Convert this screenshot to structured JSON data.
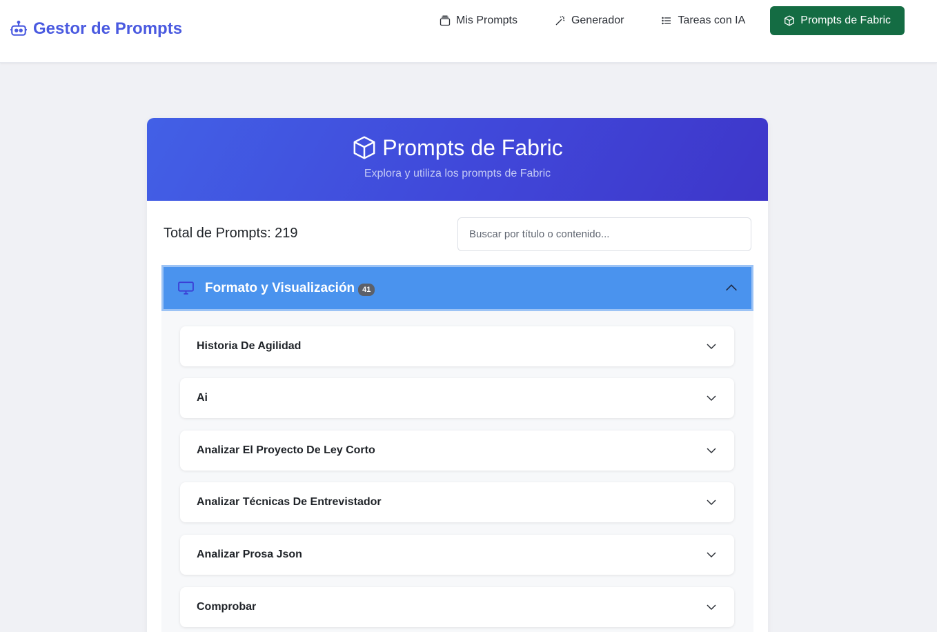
{
  "navbar": {
    "brand": "Gestor de Prompts",
    "brand_icon": "robot-icon",
    "links": [
      {
        "label": "Mis Prompts",
        "icon": "collection-icon"
      },
      {
        "label": "Generador",
        "icon": "magic-wand-icon"
      },
      {
        "label": "Tareas con IA",
        "icon": "list-icon"
      },
      {
        "label": "Prompts de Fabric",
        "icon": "box-icon",
        "active": true
      }
    ]
  },
  "header": {
    "title": "Prompts de Fabric",
    "subtitle": "Explora y utiliza los prompts de Fabric"
  },
  "stats": {
    "total_label": "Total de Prompts: 219"
  },
  "search": {
    "placeholder": "Buscar por título o contenido..."
  },
  "category": {
    "label": "Formato y Visualización",
    "count": "41",
    "icon": "monitor-icon",
    "expanded": true,
    "items": [
      {
        "label": "Historia De Agilidad"
      },
      {
        "label": "Ai"
      },
      {
        "label": "Analizar El Proyecto De Ley Corto"
      },
      {
        "label": "Analizar Técnicas De Entrevistador"
      },
      {
        "label": "Analizar Prosa Json"
      },
      {
        "label": "Comprobar"
      }
    ]
  },
  "colors": {
    "brand": "#4a5ae0",
    "active_nav": "#146c43",
    "header_gradient_start": "#4260e6",
    "header_gradient_end": "#3e36c9",
    "category_header": "#4a93ee"
  }
}
